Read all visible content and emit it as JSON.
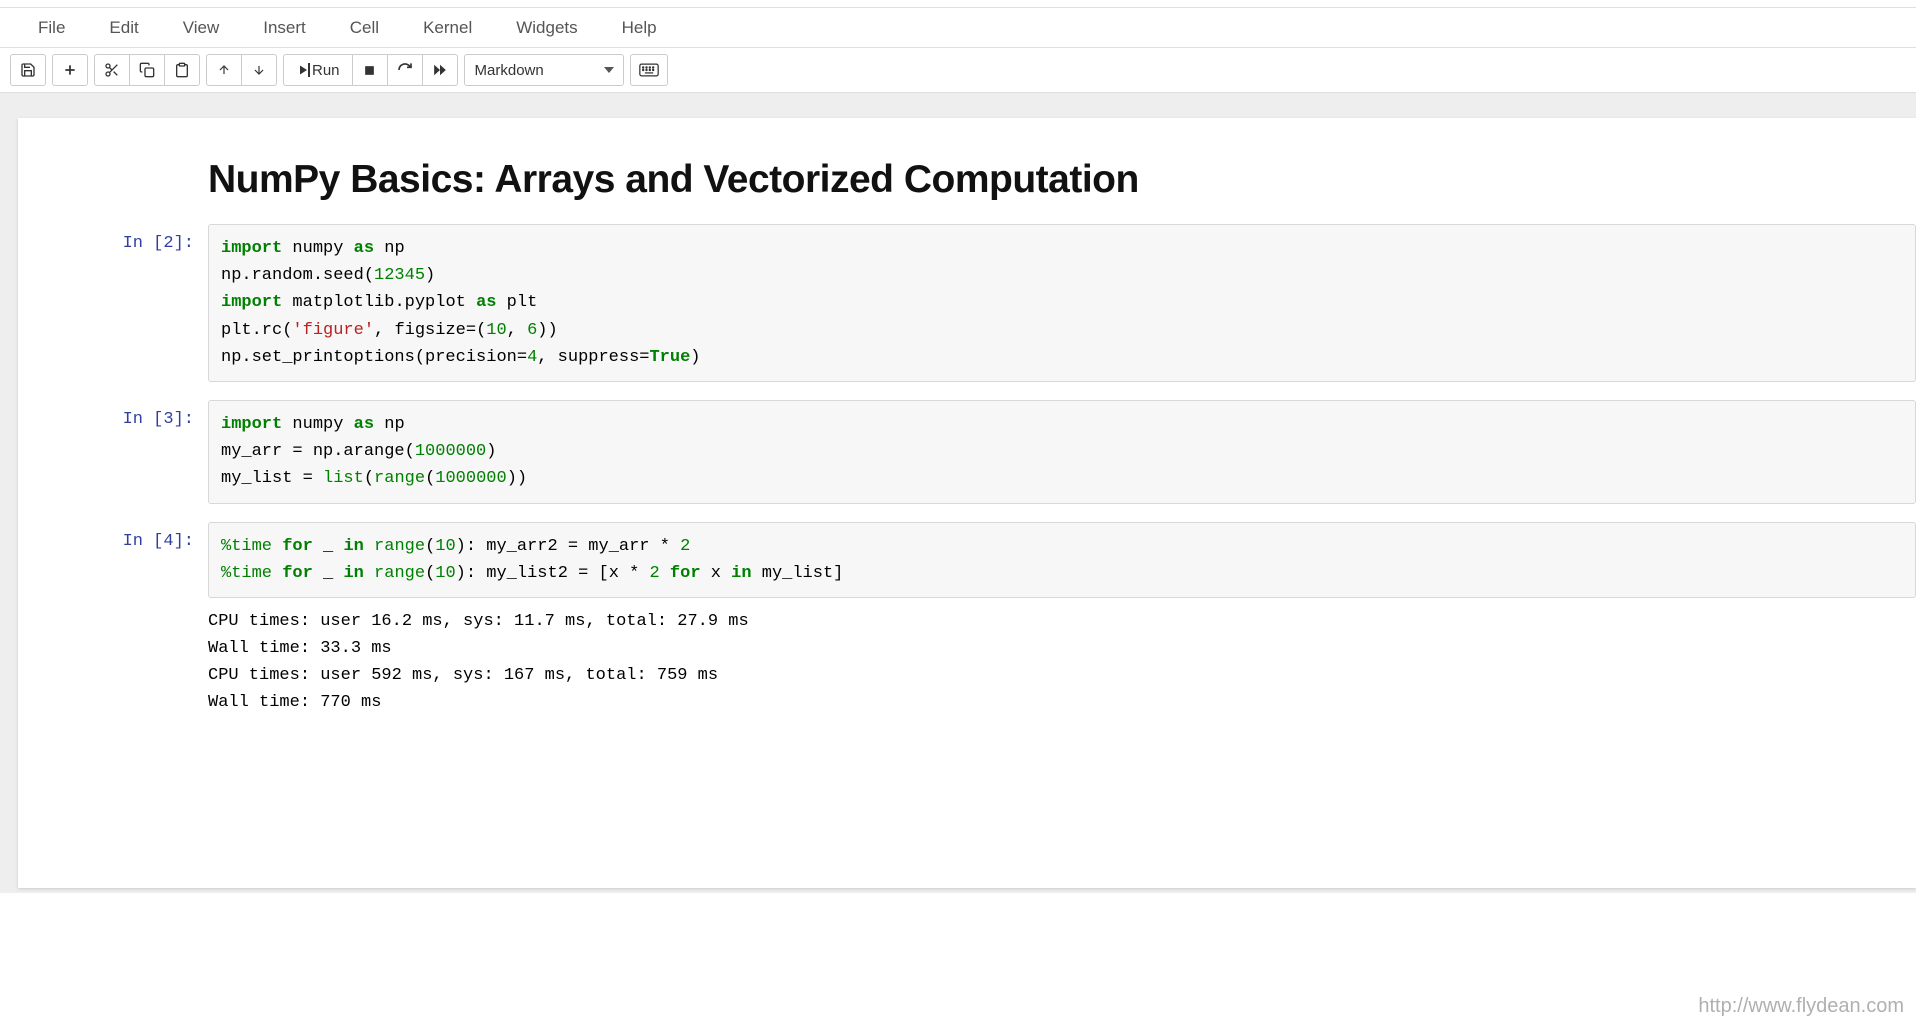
{
  "menu": {
    "file": "File",
    "edit": "Edit",
    "view": "View",
    "insert": "Insert",
    "cell": "Cell",
    "kernel": "Kernel",
    "widgets": "Widgets",
    "help": "Help"
  },
  "toolbar": {
    "run_label": "Run",
    "cell_type": "Markdown"
  },
  "markdown": {
    "title": "NumPy Basics: Arrays and Vectorized Computation"
  },
  "cells": {
    "c1": {
      "prompt": "In [2]:",
      "tokens": [
        {
          "t": "import",
          "c": "kw"
        },
        {
          "t": " ",
          "c": "p"
        },
        {
          "t": "numpy",
          "c": "nn"
        },
        {
          "t": " ",
          "c": "p"
        },
        {
          "t": "as",
          "c": "kw"
        },
        {
          "t": " ",
          "c": "p"
        },
        {
          "t": "np",
          "c": "nn"
        },
        {
          "t": "\n",
          "c": "p"
        },
        {
          "t": "np.random.seed(",
          "c": "n"
        },
        {
          "t": "12345",
          "c": "mi"
        },
        {
          "t": ")",
          "c": "n"
        },
        {
          "t": "\n",
          "c": "p"
        },
        {
          "t": "import",
          "c": "kw"
        },
        {
          "t": " ",
          "c": "p"
        },
        {
          "t": "matplotlib.pyplot",
          "c": "nn"
        },
        {
          "t": " ",
          "c": "p"
        },
        {
          "t": "as",
          "c": "kw"
        },
        {
          "t": " ",
          "c": "p"
        },
        {
          "t": "plt",
          "c": "nn"
        },
        {
          "t": "\n",
          "c": "p"
        },
        {
          "t": "plt.rc(",
          "c": "n"
        },
        {
          "t": "'figure'",
          "c": "s"
        },
        {
          "t": ", figsize=(",
          "c": "n"
        },
        {
          "t": "10",
          "c": "mi"
        },
        {
          "t": ", ",
          "c": "n"
        },
        {
          "t": "6",
          "c": "mi"
        },
        {
          "t": "))",
          "c": "n"
        },
        {
          "t": "\n",
          "c": "p"
        },
        {
          "t": "np.set_printoptions(precision=",
          "c": "n"
        },
        {
          "t": "4",
          "c": "mi"
        },
        {
          "t": ", suppress=",
          "c": "n"
        },
        {
          "t": "True",
          "c": "bt"
        },
        {
          "t": ")",
          "c": "n"
        }
      ]
    },
    "c2": {
      "prompt": "In [3]:",
      "tokens": [
        {
          "t": "import",
          "c": "kw"
        },
        {
          "t": " ",
          "c": "p"
        },
        {
          "t": "numpy",
          "c": "nn"
        },
        {
          "t": " ",
          "c": "p"
        },
        {
          "t": "as",
          "c": "kw"
        },
        {
          "t": " ",
          "c": "p"
        },
        {
          "t": "np",
          "c": "nn"
        },
        {
          "t": "\n",
          "c": "p"
        },
        {
          "t": "my_arr = np.arange(",
          "c": "n"
        },
        {
          "t": "1000000",
          "c": "mi"
        },
        {
          "t": ")",
          "c": "n"
        },
        {
          "t": "\n",
          "c": "p"
        },
        {
          "t": "my_list = ",
          "c": "n"
        },
        {
          "t": "list",
          "c": "bi"
        },
        {
          "t": "(",
          "c": "n"
        },
        {
          "t": "range",
          "c": "bi"
        },
        {
          "t": "(",
          "c": "n"
        },
        {
          "t": "1000000",
          "c": "mi"
        },
        {
          "t": "))",
          "c": "n"
        }
      ]
    },
    "c3": {
      "prompt": "In [4]:",
      "tokens": [
        {
          "t": "%time ",
          "c": "mg"
        },
        {
          "t": "for",
          "c": "kw"
        },
        {
          "t": " _ ",
          "c": "n"
        },
        {
          "t": "in",
          "c": "kw"
        },
        {
          "t": " ",
          "c": "n"
        },
        {
          "t": "range",
          "c": "bi"
        },
        {
          "t": "(",
          "c": "n"
        },
        {
          "t": "10",
          "c": "mi"
        },
        {
          "t": "): my_arr2 = my_arr * ",
          "c": "n"
        },
        {
          "t": "2",
          "c": "mi"
        },
        {
          "t": "\n",
          "c": "p"
        },
        {
          "t": "%time ",
          "c": "mg"
        },
        {
          "t": "for",
          "c": "kw"
        },
        {
          "t": " _ ",
          "c": "n"
        },
        {
          "t": "in",
          "c": "kw"
        },
        {
          "t": " ",
          "c": "n"
        },
        {
          "t": "range",
          "c": "bi"
        },
        {
          "t": "(",
          "c": "n"
        },
        {
          "t": "10",
          "c": "mi"
        },
        {
          "t": "): my_list2 = [x * ",
          "c": "n"
        },
        {
          "t": "2",
          "c": "mi"
        },
        {
          "t": " ",
          "c": "n"
        },
        {
          "t": "for",
          "c": "kw"
        },
        {
          "t": " x ",
          "c": "n"
        },
        {
          "t": "in",
          "c": "kw"
        },
        {
          "t": " my_list]",
          "c": "n"
        }
      ],
      "output": "CPU times: user 16.2 ms, sys: 11.7 ms, total: 27.9 ms\nWall time: 33.3 ms\nCPU times: user 592 ms, sys: 167 ms, total: 759 ms\nWall time: 770 ms"
    }
  },
  "watermark": "http://www.flydean.com"
}
